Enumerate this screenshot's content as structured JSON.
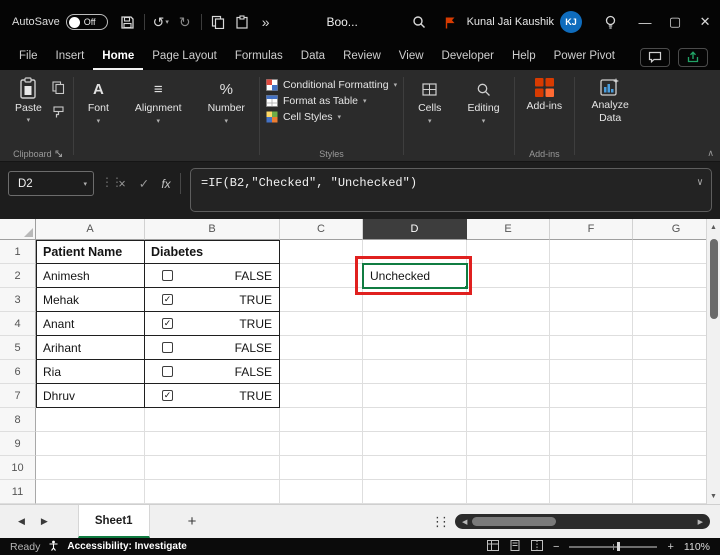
{
  "titlebar": {
    "autosave_label": "AutoSave",
    "autosave_state": "Off",
    "doc_title": "Boo...",
    "user_name": "Kunal Jai Kaushik",
    "user_initials": "KJ"
  },
  "menubar": {
    "items": [
      "File",
      "Insert",
      "Home",
      "Page Layout",
      "Formulas",
      "Data",
      "Review",
      "View",
      "Developer",
      "Help",
      "Power Pivot"
    ],
    "active_item": "Home"
  },
  "ribbon": {
    "paste": "Paste",
    "font": "Font",
    "alignment": "Alignment",
    "number": "Number",
    "conditional_formatting": "Conditional Formatting",
    "format_as_table": "Format as Table",
    "cell_styles": "Cell Styles",
    "cells": "Cells",
    "editing": "Editing",
    "addins_button": "Add-ins",
    "analyze_data": "Analyze Data",
    "group_clipboard": "Clipboard",
    "group_styles": "Styles",
    "group_addins": "Add-ins"
  },
  "formula_bar": {
    "name_box": "D2",
    "formula": "=IF(B2,\"Checked\", \"Unchecked\")"
  },
  "grid": {
    "columns": [
      "A",
      "B",
      "C",
      "D",
      "E",
      "F",
      "G"
    ],
    "rows": [
      "1",
      "2",
      "3",
      "4",
      "5",
      "6",
      "7",
      "8",
      "9",
      "10",
      "11"
    ],
    "selected_cell": "D2",
    "d2_value": "Unchecked",
    "table": {
      "header_name": "Patient Name",
      "header_diabetes": "Diabetes",
      "rows": [
        {
          "name": "Animesh",
          "check": "",
          "value": "FALSE"
        },
        {
          "name": "Mehak",
          "check": "✓",
          "value": "TRUE"
        },
        {
          "name": "Anant",
          "check": "✓",
          "value": "TRUE"
        },
        {
          "name": "Arihant",
          "check": "",
          "value": "FALSE"
        },
        {
          "name": "Ria",
          "check": "",
          "value": "FALSE"
        },
        {
          "name": "Dhruv",
          "check": "✓",
          "value": "TRUE"
        }
      ]
    }
  },
  "sheet_tabs": {
    "active_tab": "Sheet1"
  },
  "status_bar": {
    "ready": "Ready",
    "accessibility": "Accessibility: Investigate",
    "zoom": "110%"
  },
  "icons": {
    "undo": "↺",
    "redo": "↻",
    "more": "»",
    "dropdown": "▾",
    "cancel": "×",
    "enter": "✓",
    "fx": "fx",
    "collapse": "∨",
    "ribbon_collapse": "∧",
    "grip": "⋮⋮",
    "left": "◀",
    "right": "▶",
    "up": "▲",
    "down": "▼",
    "add": "+",
    "minus": "−",
    "plus": "+",
    "font_a": "A",
    "align": "≡",
    "percent": "%",
    "minimize": "—",
    "maximize": "▢",
    "close": "✕"
  },
  "colors": {
    "excel_green": "#107c41",
    "annotation_red": "#e0201f",
    "addin_orange": "#d83b01",
    "avatar_blue": "#0f6cbd"
  }
}
